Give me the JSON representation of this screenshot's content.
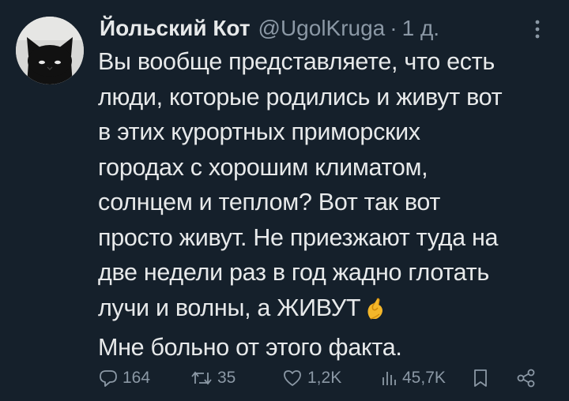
{
  "author": {
    "display_name": "Йольский Кот",
    "handle": "@UgolKruga",
    "separator": "·",
    "time": "1 д."
  },
  "tweet": {
    "lines": [
      "Вы вообще представляете, что есть",
      "люди, которые родились и живут вот",
      "в этих курортных приморских",
      "городах с хорошим климатом,",
      "солнцем и теплом? Вот так вот",
      "просто живут. Не приезжают туда на",
      "две недели раз в год жадно глотать",
      "лучи и волны, а ЖИВУТ",
      "Мне больно от этого факта."
    ],
    "emoji": "pinching-hand-emoji"
  },
  "actions": {
    "replies": "164",
    "retweets": "35",
    "likes": "1,2K",
    "views": "45,7K"
  },
  "icons": [
    "more-icon",
    "reply-icon",
    "retweet-icon",
    "like-icon",
    "views-icon",
    "bookmark-icon",
    "share-icon"
  ],
  "colors": {
    "background": "#15202b",
    "text": "#e7e9ea",
    "secondary": "#8b98a5"
  }
}
